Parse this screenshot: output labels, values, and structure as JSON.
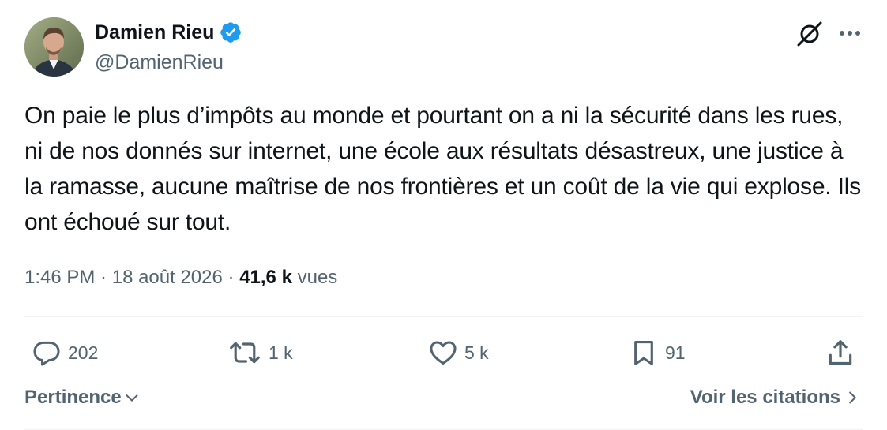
{
  "author": {
    "display_name": "Damien Rieu",
    "handle": "@DamienRieu",
    "verified": true,
    "avatar_icon": "avatar",
    "verified_icon": "verified-badge-icon",
    "verified_color": "#1d9bf0"
  },
  "header_icons": {
    "grok": "grok-icon",
    "more": "more-options-icon"
  },
  "tweet": {
    "text": "On paie le plus d’impôts au monde et pourtant on a ni la sécurité dans les rues, ni de nos donnés sur internet, une école aux résultats désastreux, une justice à la ramasse, aucune maîtrise de nos frontières et un coût de la vie qui explose. Ils ont échoué sur tout."
  },
  "meta": {
    "time": "1:46 PM",
    "separator": " · ",
    "date": "18 août 2026",
    "separator2": " · ",
    "views_count": "41,6 k",
    "views_label": "vues"
  },
  "actions": {
    "reply": {
      "icon": "reply-icon",
      "count": "202"
    },
    "retweet": {
      "icon": "retweet-icon",
      "count": "1 k"
    },
    "like": {
      "icon": "heart-icon",
      "count": "5 k"
    },
    "bookmark": {
      "icon": "bookmark-icon",
      "count": "91"
    },
    "share": {
      "icon": "share-icon"
    }
  },
  "footer": {
    "sort_label": "Pertinence",
    "quotes_label": "Voir les citations"
  },
  "colors": {
    "text_primary": "#0f1419",
    "text_secondary": "#536471",
    "divider": "#eff3f4",
    "accent": "#1d9bf0"
  }
}
